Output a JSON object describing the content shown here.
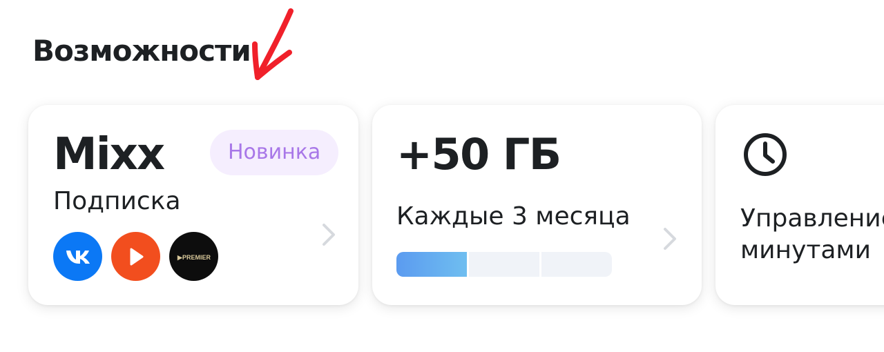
{
  "section": {
    "title": "Возможности"
  },
  "cards": {
    "mixx": {
      "brand": "Mixx",
      "badge": "Новинка",
      "subtitle": "Подписка",
      "services": [
        {
          "name": "vk",
          "icon": "vk-logo-icon",
          "color": "#0b78f5"
        },
        {
          "name": "okko",
          "icon": "play-logo-icon",
          "color": "#f24e1e"
        },
        {
          "name": "premier",
          "icon": "premier-logo-icon",
          "label": "▶PREMIER",
          "color": "#0d0d0d"
        }
      ]
    },
    "data": {
      "value": "+50 ГБ",
      "period": "Каждые 3 месяца",
      "progress": {
        "filled_segments": 1,
        "total_segments": 3
      }
    },
    "minutes": {
      "icon": "clock-icon",
      "label_line1": "Управление",
      "label_line2": "минутами"
    }
  },
  "colors": {
    "annotation_arrow": "#f0202a",
    "badge_bg": "#f5eefe",
    "badge_text": "#a877e8",
    "progress_fill": "#5b9bf0",
    "progress_track": "#f0f3f8"
  }
}
